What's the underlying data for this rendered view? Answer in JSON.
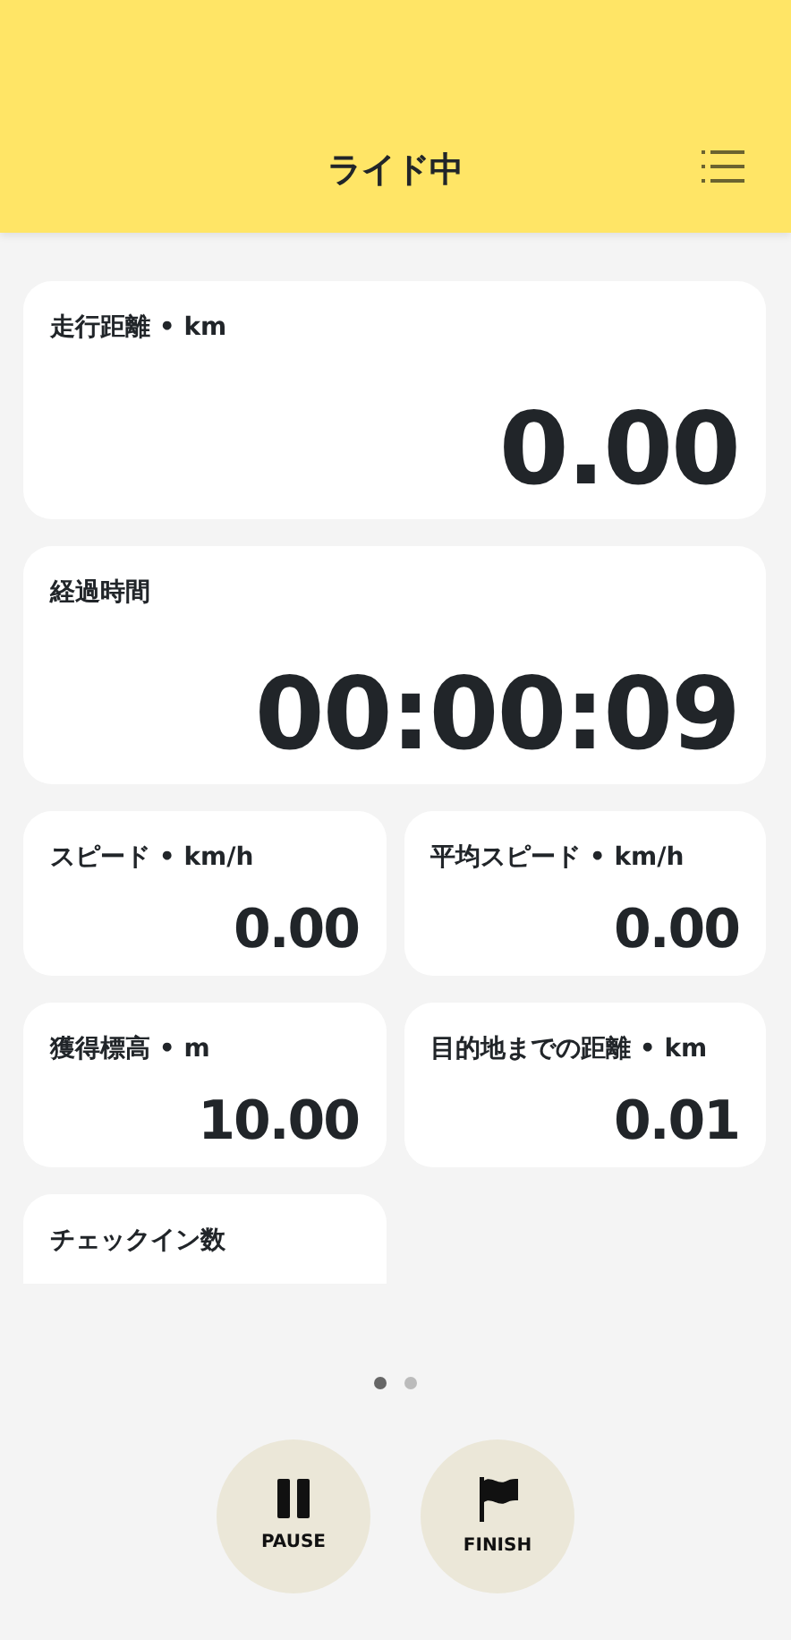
{
  "header": {
    "title": "ライド中"
  },
  "stats": [
    {
      "kind": "wide",
      "label": "走行距離 • km",
      "value": "0.00"
    },
    {
      "kind": "wide",
      "label": "経過時間",
      "value": "00:00:09"
    },
    {
      "kind": "half",
      "label": "スピード • km/h",
      "value": "0.00"
    },
    {
      "kind": "half",
      "label": "平均スピード • km/h",
      "value": "0.00"
    },
    {
      "kind": "half",
      "label": "獲得標高 • m",
      "value": "10.00"
    },
    {
      "kind": "half",
      "label": "目的地までの距離 • km",
      "value": "0.01"
    },
    {
      "kind": "half",
      "label": "チェックイン数"
    }
  ],
  "pages": [
    {
      "selected": true
    },
    {
      "selected": false
    }
  ],
  "buttons": [
    {
      "kind": "pause",
      "label": "PAUSE"
    },
    {
      "kind": "finish",
      "label": "FINISH"
    }
  ]
}
